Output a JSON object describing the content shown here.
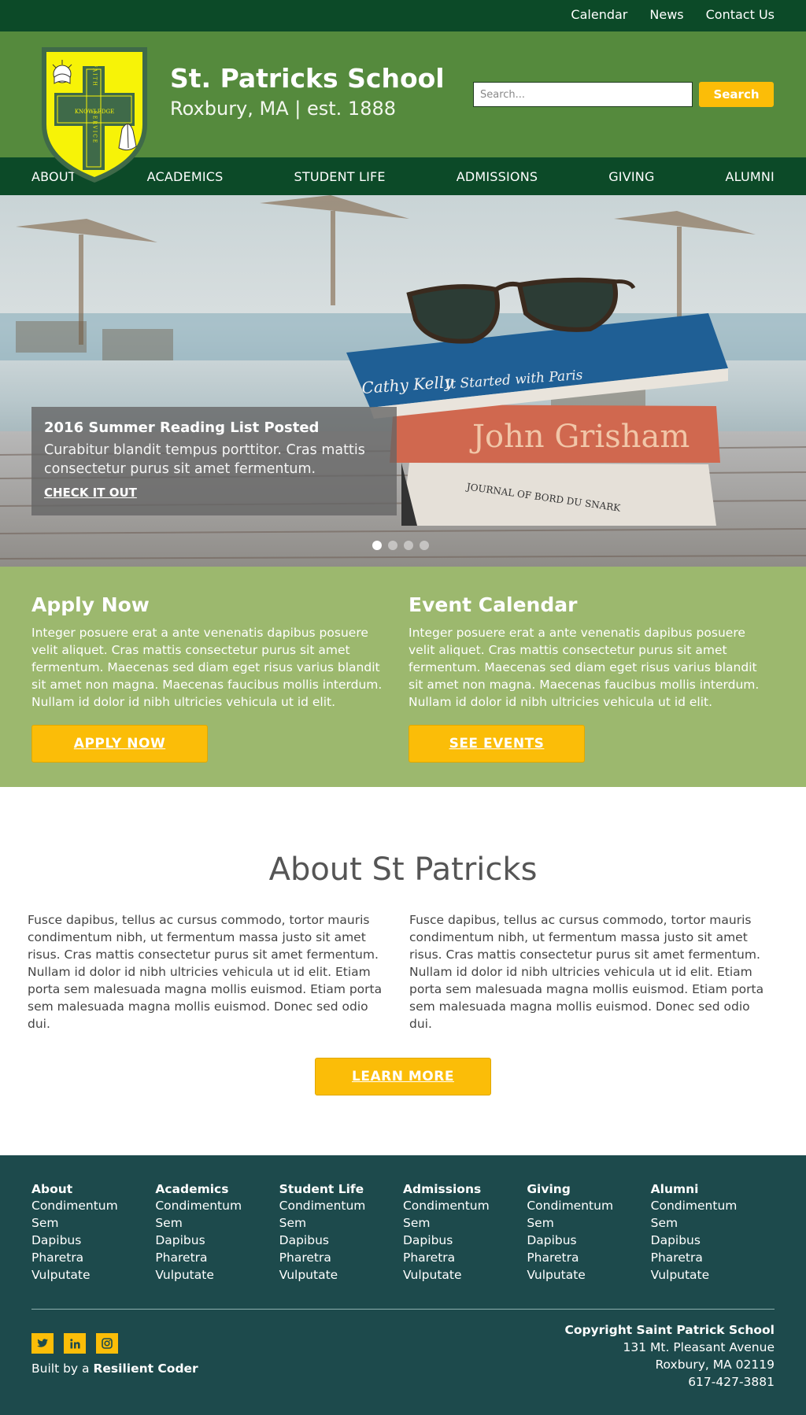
{
  "topbar": {
    "links": [
      "Calendar",
      "News",
      "Contact Us"
    ]
  },
  "header": {
    "crest_text": {
      "vertical_top": "FAITH",
      "center": "KNOWLEDGE",
      "vertical_bottom": "SERVICE"
    },
    "school_name": "St. Patricks School",
    "subtitle": "Roxbury, MA | est. 1888",
    "search_placeholder": "Search...",
    "search_button": "Search"
  },
  "nav": {
    "items": [
      "ABOUT",
      "ACADEMICS",
      "STUDENT LIFE",
      "ADMISSIONS",
      "GIVING",
      "ALUMNI"
    ]
  },
  "hero": {
    "book_texts": [
      "Cathy Kelly",
      "It Started with Paris",
      "John Grisham",
      "JOURNAL OF BORD DU SNARK"
    ],
    "caption_title": "2016 Summer Reading List Posted",
    "caption_text": "Curabitur blandit tempus porttitor. Cras mattis consectetur purus sit amet fermentum.",
    "caption_link": "CHECK IT OUT",
    "slide_count": 4,
    "active_slide": 1
  },
  "cta": {
    "apply": {
      "title": "Apply Now",
      "text": "Integer posuere erat a ante venenatis dapibus posuere velit aliquet. Cras mattis consectetur purus sit amet fermentum. Maecenas sed diam eget risus varius blandit sit amet non magna. Maecenas faucibus mollis interdum. Nullam id dolor id nibh ultricies vehicula ut id elit.",
      "button": "APPLY NOW"
    },
    "events": {
      "title": "Event Calendar",
      "text": "Integer posuere erat a ante venenatis dapibus posuere velit aliquet. Cras mattis consectetur purus sit amet fermentum. Maecenas sed diam eget risus varius blandit sit amet non magna. Maecenas faucibus mollis interdum. Nullam id dolor id nibh ultricies vehicula ut id elit.",
      "button": "SEE EVENTS"
    }
  },
  "about": {
    "title": "About St Patricks",
    "col1": "Fusce dapibus, tellus ac cursus commodo, tortor mauris condimentum nibh, ut fermentum massa justo sit amet risus. Cras mattis consectetur purus sit amet fermentum. Nullam id dolor id nibh ultricies vehicula ut id elit. Etiam porta sem malesuada magna mollis euismod. Etiam porta sem malesuada magna mollis euismod. Donec sed odio dui.",
    "col2": "Fusce dapibus, tellus ac cursus commodo, tortor mauris condimentum nibh, ut fermentum massa justo sit amet risus. Cras mattis consectetur purus sit amet fermentum. Nullam id dolor id nibh ultricies vehicula ut id elit. Etiam porta sem malesuada magna mollis euismod. Etiam porta sem malesuada magna mollis euismod. Donec sed odio dui.",
    "button": "LEARN MORE"
  },
  "footer": {
    "columns": [
      {
        "title": "About",
        "links": [
          "Condimentum",
          "Sem",
          "Dapibus",
          "Pharetra",
          "Vulputate"
        ]
      },
      {
        "title": "Academics",
        "links": [
          "Condimentum",
          "Sem",
          "Dapibus",
          "Pharetra",
          "Vulputate"
        ]
      },
      {
        "title": "Student Life",
        "links": [
          "Condimentum",
          "Sem",
          "Dapibus",
          "Pharetra",
          "Vulputate"
        ]
      },
      {
        "title": "Admissions",
        "links": [
          "Condimentum",
          "Sem",
          "Dapibus",
          "Pharetra",
          "Vulputate"
        ]
      },
      {
        "title": "Giving",
        "links": [
          "Condimentum",
          "Sem",
          "Dapibus",
          "Pharetra",
          "Vulputate"
        ]
      },
      {
        "title": "Alumni",
        "links": [
          "Condimentum",
          "Sem",
          "Dapibus",
          "Pharetra",
          "Vulputate"
        ]
      }
    ],
    "social_icons": [
      "twitter-icon",
      "linkedin-icon",
      "instagram-icon"
    ],
    "built_prefix": "Built by a",
    "built_name": "Resilient Coder",
    "copyright": "Copyright Saint Patrick School",
    "address1": "131 Mt. Pleasant Avenue",
    "address2": "Roxbury, MA 02119",
    "phone": "617-427-3881"
  },
  "colors": {
    "dark_green": "#0c4a28",
    "header_green": "#558a3d",
    "light_green": "#9cb86e",
    "accent_yellow": "#fbbd08",
    "footer_teal": "#1d4a4c"
  }
}
